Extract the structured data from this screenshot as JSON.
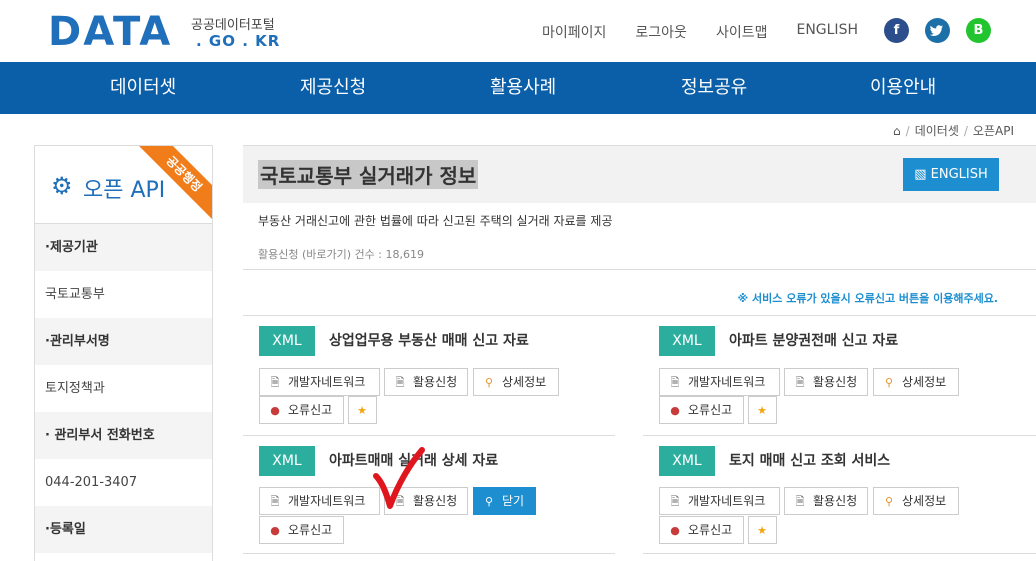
{
  "header": {
    "logo_main": "DATA",
    "logo_sub1": "공공데이터포털",
    "logo_sub2": ". GO . KR",
    "links": [
      "마이페이지",
      "로그아웃",
      "사이트맵",
      "ENGLISH"
    ],
    "social": {
      "facebook": "f",
      "twitter": "t",
      "blog": "B"
    }
  },
  "nav": {
    "items": [
      "데이터셋",
      "제공신청",
      "활용사례",
      "정보공유",
      "이용안내"
    ]
  },
  "breadcrumb": {
    "home_icon": "home-icon",
    "items": [
      "데이터셋",
      "오픈API"
    ]
  },
  "sidebar": {
    "title": "오픈 API",
    "ribbon": "공공행정",
    "rows": [
      {
        "label": "·제공기관",
        "type": "head"
      },
      {
        "label": "국토교통부",
        "type": "val"
      },
      {
        "label": "·관리부서명",
        "type": "head"
      },
      {
        "label": "토지정책과",
        "type": "val"
      },
      {
        "label": "· 관리부서 전화번호",
        "type": "head"
      },
      {
        "label": "044-201-3407",
        "type": "val"
      },
      {
        "label": "·등록일",
        "type": "head"
      }
    ]
  },
  "main": {
    "title": "국토교통부 실거래가 정보",
    "english_button": "ENGLISH",
    "description": "부동산 거래신고에 관한 법률에 따라 신고된 주택의 실거래 자료를 제공",
    "meta": "활용신청 (바로가기) 건수 : 18,619",
    "notice": "※ 서비스 오류가 있을시 오류신고 버튼을 이용해주세요."
  },
  "cards": [
    {
      "badge": "XML",
      "title": "상업업무용 부동산 매매 신고 자료",
      "btn_dev": "개발자네트워크",
      "btn_apply": "활용신청",
      "btn_detail": "상세정보",
      "btn_error": "오류신고"
    },
    {
      "badge": "XML",
      "title": "아파트 분양권전매 신고 자료",
      "btn_dev": "개발자네트워크",
      "btn_apply": "활용신청",
      "btn_detail": "상세정보",
      "btn_error": "오류신고"
    },
    {
      "badge": "XML",
      "title": "아파트매매 실거래 상세 자료",
      "btn_dev": "개발자네트워크",
      "btn_apply": "활용신청",
      "btn_close": "닫기",
      "btn_error": "오류신고"
    },
    {
      "badge": "XML",
      "title": "토지 매매 신고 조회 서비스",
      "btn_dev": "개발자네트워크",
      "btn_apply": "활용신청",
      "btn_detail": "상세정보",
      "btn_error": "오류신고"
    }
  ],
  "colors": {
    "nav_bg": "#0b5ea8",
    "brand": "#1f6fba",
    "xml_badge": "#2cae9f",
    "accent_button": "#1d8fd0",
    "ribbon": "#f07c1a",
    "checkmark": "#e0161e"
  }
}
